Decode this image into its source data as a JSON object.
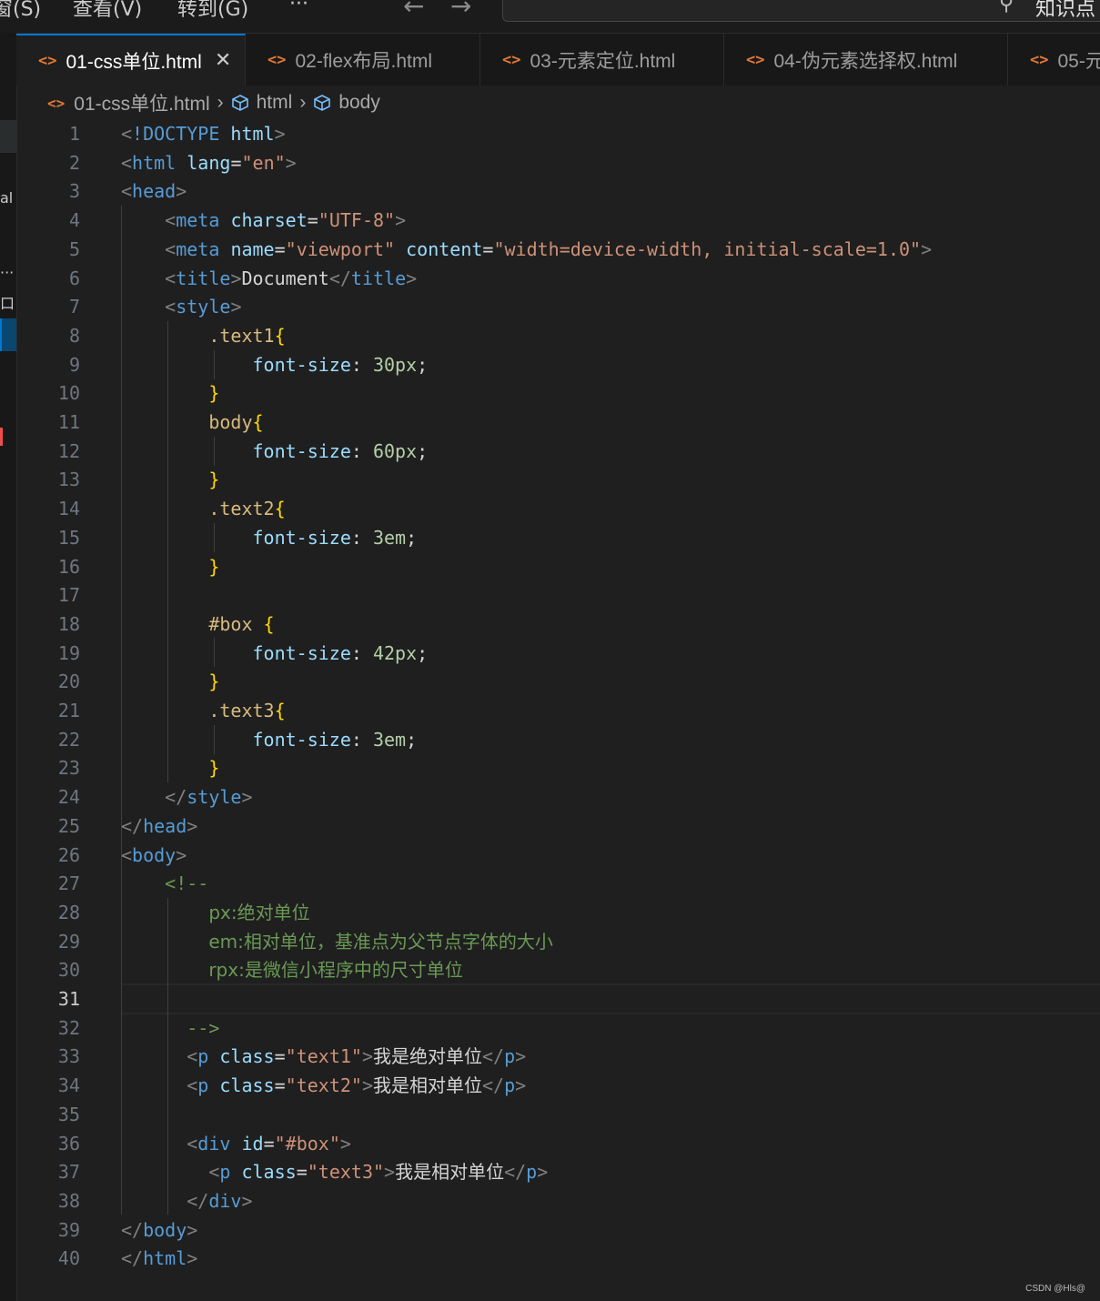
{
  "menu": {
    "items": [
      "窗(S)",
      "查看(V)",
      "转到(G)",
      "···"
    ],
    "search_text": "知识点"
  },
  "activity": {
    "marks": [
      "al",
      "···",
      "口"
    ]
  },
  "tabs": [
    {
      "icon": "<>",
      "label": "01-css单位.html",
      "close": "✕",
      "active": true
    },
    {
      "icon": "<>",
      "label": "02-flex布局.html"
    },
    {
      "icon": "<>",
      "label": "03-元素定位.html"
    },
    {
      "icon": "<>",
      "label": "04-伪元素选择权.html"
    },
    {
      "icon": "<>",
      "label": "05-元"
    }
  ],
  "breadcrumb": {
    "file": "01-css单位.html",
    "item1": "html",
    "item2": "body"
  },
  "editor": {
    "current_line": 31,
    "lines": [
      [
        [
          "br",
          "<"
        ],
        [
          "tag",
          "!DOCTYPE"
        ],
        [
          "text",
          " "
        ],
        [
          "attr",
          "html"
        ],
        [
          "br",
          ">"
        ]
      ],
      [
        [
          "br",
          "<"
        ],
        [
          "tag",
          "html"
        ],
        [
          "text",
          " "
        ],
        [
          "attr",
          "lang"
        ],
        [
          "text",
          "="
        ],
        [
          "str",
          "\"en\""
        ],
        [
          "br",
          ">"
        ]
      ],
      [
        [
          "br",
          "<"
        ],
        [
          "tag",
          "head"
        ],
        [
          "br",
          ">"
        ]
      ],
      [
        [
          "text",
          "    "
        ],
        [
          "br",
          "<"
        ],
        [
          "tag",
          "meta"
        ],
        [
          "text",
          " "
        ],
        [
          "attr",
          "charset"
        ],
        [
          "text",
          "="
        ],
        [
          "str",
          "\"UTF-8\""
        ],
        [
          "br",
          ">"
        ]
      ],
      [
        [
          "text",
          "    "
        ],
        [
          "br",
          "<"
        ],
        [
          "tag",
          "meta"
        ],
        [
          "text",
          " "
        ],
        [
          "attr",
          "name"
        ],
        [
          "text",
          "="
        ],
        [
          "str",
          "\"viewport\""
        ],
        [
          "text",
          " "
        ],
        [
          "attr",
          "content"
        ],
        [
          "text",
          "="
        ],
        [
          "str",
          "\"width=device-width, initial-scale=1.0\""
        ],
        [
          "br",
          ">"
        ]
      ],
      [
        [
          "text",
          "    "
        ],
        [
          "br",
          "<"
        ],
        [
          "tag",
          "title"
        ],
        [
          "br",
          ">"
        ],
        [
          "text",
          "Document"
        ],
        [
          "br",
          "</"
        ],
        [
          "tag",
          "title"
        ],
        [
          "br",
          ">"
        ]
      ],
      [
        [
          "text",
          "    "
        ],
        [
          "br",
          "<"
        ],
        [
          "tag",
          "style"
        ],
        [
          "br",
          ">"
        ]
      ],
      [
        [
          "text",
          "        "
        ],
        [
          "sel",
          ".text1"
        ],
        [
          "brace",
          "{"
        ]
      ],
      [
        [
          "text",
          "            "
        ],
        [
          "prop",
          "font-size"
        ],
        [
          "text",
          ": "
        ],
        [
          "num",
          "30px"
        ],
        [
          "text",
          ";"
        ]
      ],
      [
        [
          "text",
          "        "
        ],
        [
          "brace",
          "}"
        ]
      ],
      [
        [
          "text",
          "        "
        ],
        [
          "sel",
          "body"
        ],
        [
          "brace",
          "{"
        ]
      ],
      [
        [
          "text",
          "            "
        ],
        [
          "prop",
          "font-size"
        ],
        [
          "text",
          ": "
        ],
        [
          "num",
          "60px"
        ],
        [
          "text",
          ";"
        ]
      ],
      [
        [
          "text",
          "        "
        ],
        [
          "brace",
          "}"
        ]
      ],
      [
        [
          "text",
          "        "
        ],
        [
          "sel",
          ".text2"
        ],
        [
          "brace",
          "{"
        ]
      ],
      [
        [
          "text",
          "            "
        ],
        [
          "prop",
          "font-size"
        ],
        [
          "text",
          ": "
        ],
        [
          "num",
          "3em"
        ],
        [
          "text",
          ";"
        ]
      ],
      [
        [
          "text",
          "        "
        ],
        [
          "brace",
          "}"
        ]
      ],
      [],
      [
        [
          "text",
          "        "
        ],
        [
          "sel",
          "#box"
        ],
        [
          "text",
          " "
        ],
        [
          "brace",
          "{"
        ]
      ],
      [
        [
          "text",
          "            "
        ],
        [
          "prop",
          "font-size"
        ],
        [
          "text",
          ": "
        ],
        [
          "num",
          "42px"
        ],
        [
          "text",
          ";"
        ]
      ],
      [
        [
          "text",
          "        "
        ],
        [
          "brace",
          "}"
        ]
      ],
      [
        [
          "text",
          "        "
        ],
        [
          "sel",
          ".text3"
        ],
        [
          "brace",
          "{"
        ]
      ],
      [
        [
          "text",
          "            "
        ],
        [
          "prop",
          "font-size"
        ],
        [
          "text",
          ": "
        ],
        [
          "num",
          "3em"
        ],
        [
          "text",
          ";"
        ]
      ],
      [
        [
          "text",
          "        "
        ],
        [
          "brace",
          "}"
        ]
      ],
      [
        [
          "text",
          "    "
        ],
        [
          "br",
          "</"
        ],
        [
          "tag",
          "style"
        ],
        [
          "br",
          ">"
        ]
      ],
      [
        [
          "br",
          "</"
        ],
        [
          "tag",
          "head"
        ],
        [
          "br",
          ">"
        ]
      ],
      [
        [
          "br",
          "<"
        ],
        [
          "tag",
          "body"
        ],
        [
          "br",
          ">"
        ]
      ],
      [
        [
          "text",
          "    "
        ],
        [
          "com",
          "<!--"
        ]
      ],
      [
        [
          "text",
          "        "
        ],
        [
          "com",
          "px:绝对单位"
        ]
      ],
      [
        [
          "text",
          "        "
        ],
        [
          "com",
          "em:相对单位，基准点为父节点字体的大小"
        ]
      ],
      [
        [
          "text",
          "        "
        ],
        [
          "com",
          "rpx:是微信小程序中的尺寸单位"
        ]
      ],
      [],
      [
        [
          "text",
          "      "
        ],
        [
          "com",
          "-->"
        ]
      ],
      [
        [
          "text",
          "      "
        ],
        [
          "br",
          "<"
        ],
        [
          "tag",
          "p"
        ],
        [
          "text",
          " "
        ],
        [
          "attr",
          "class"
        ],
        [
          "text",
          "="
        ],
        [
          "str",
          "\"text1\""
        ],
        [
          "br",
          ">"
        ],
        [
          "text",
          "我是绝对单位"
        ],
        [
          "br",
          "</"
        ],
        [
          "tag",
          "p"
        ],
        [
          "br",
          ">"
        ]
      ],
      [
        [
          "text",
          "      "
        ],
        [
          "br",
          "<"
        ],
        [
          "tag",
          "p"
        ],
        [
          "text",
          " "
        ],
        [
          "attr",
          "class"
        ],
        [
          "text",
          "="
        ],
        [
          "str",
          "\"text2\""
        ],
        [
          "br",
          ">"
        ],
        [
          "text",
          "我是相对单位"
        ],
        [
          "br",
          "</"
        ],
        [
          "tag",
          "p"
        ],
        [
          "br",
          ">"
        ]
      ],
      [],
      [
        [
          "text",
          "      "
        ],
        [
          "br",
          "<"
        ],
        [
          "tag",
          "div"
        ],
        [
          "text",
          " "
        ],
        [
          "attr",
          "id"
        ],
        [
          "text",
          "="
        ],
        [
          "str",
          "\"#box\""
        ],
        [
          "br",
          ">"
        ]
      ],
      [
        [
          "text",
          "        "
        ],
        [
          "br",
          "<"
        ],
        [
          "tag",
          "p"
        ],
        [
          "text",
          " "
        ],
        [
          "attr",
          "class"
        ],
        [
          "text",
          "="
        ],
        [
          "str",
          "\"text3\""
        ],
        [
          "br",
          ">"
        ],
        [
          "text",
          "我是相对单位"
        ],
        [
          "br",
          "</"
        ],
        [
          "tag",
          "p"
        ],
        [
          "br",
          ">"
        ]
      ],
      [
        [
          "text",
          "      "
        ],
        [
          "br",
          "</"
        ],
        [
          "tag",
          "div"
        ],
        [
          "br",
          ">"
        ]
      ],
      [
        [
          "br",
          "</"
        ],
        [
          "tag",
          "body"
        ],
        [
          "br",
          ">"
        ]
      ],
      [
        [
          "br",
          "</"
        ],
        [
          "tag",
          "html"
        ],
        [
          "br",
          ">"
        ]
      ]
    ]
  },
  "watermark": "CSDN @Hls@"
}
